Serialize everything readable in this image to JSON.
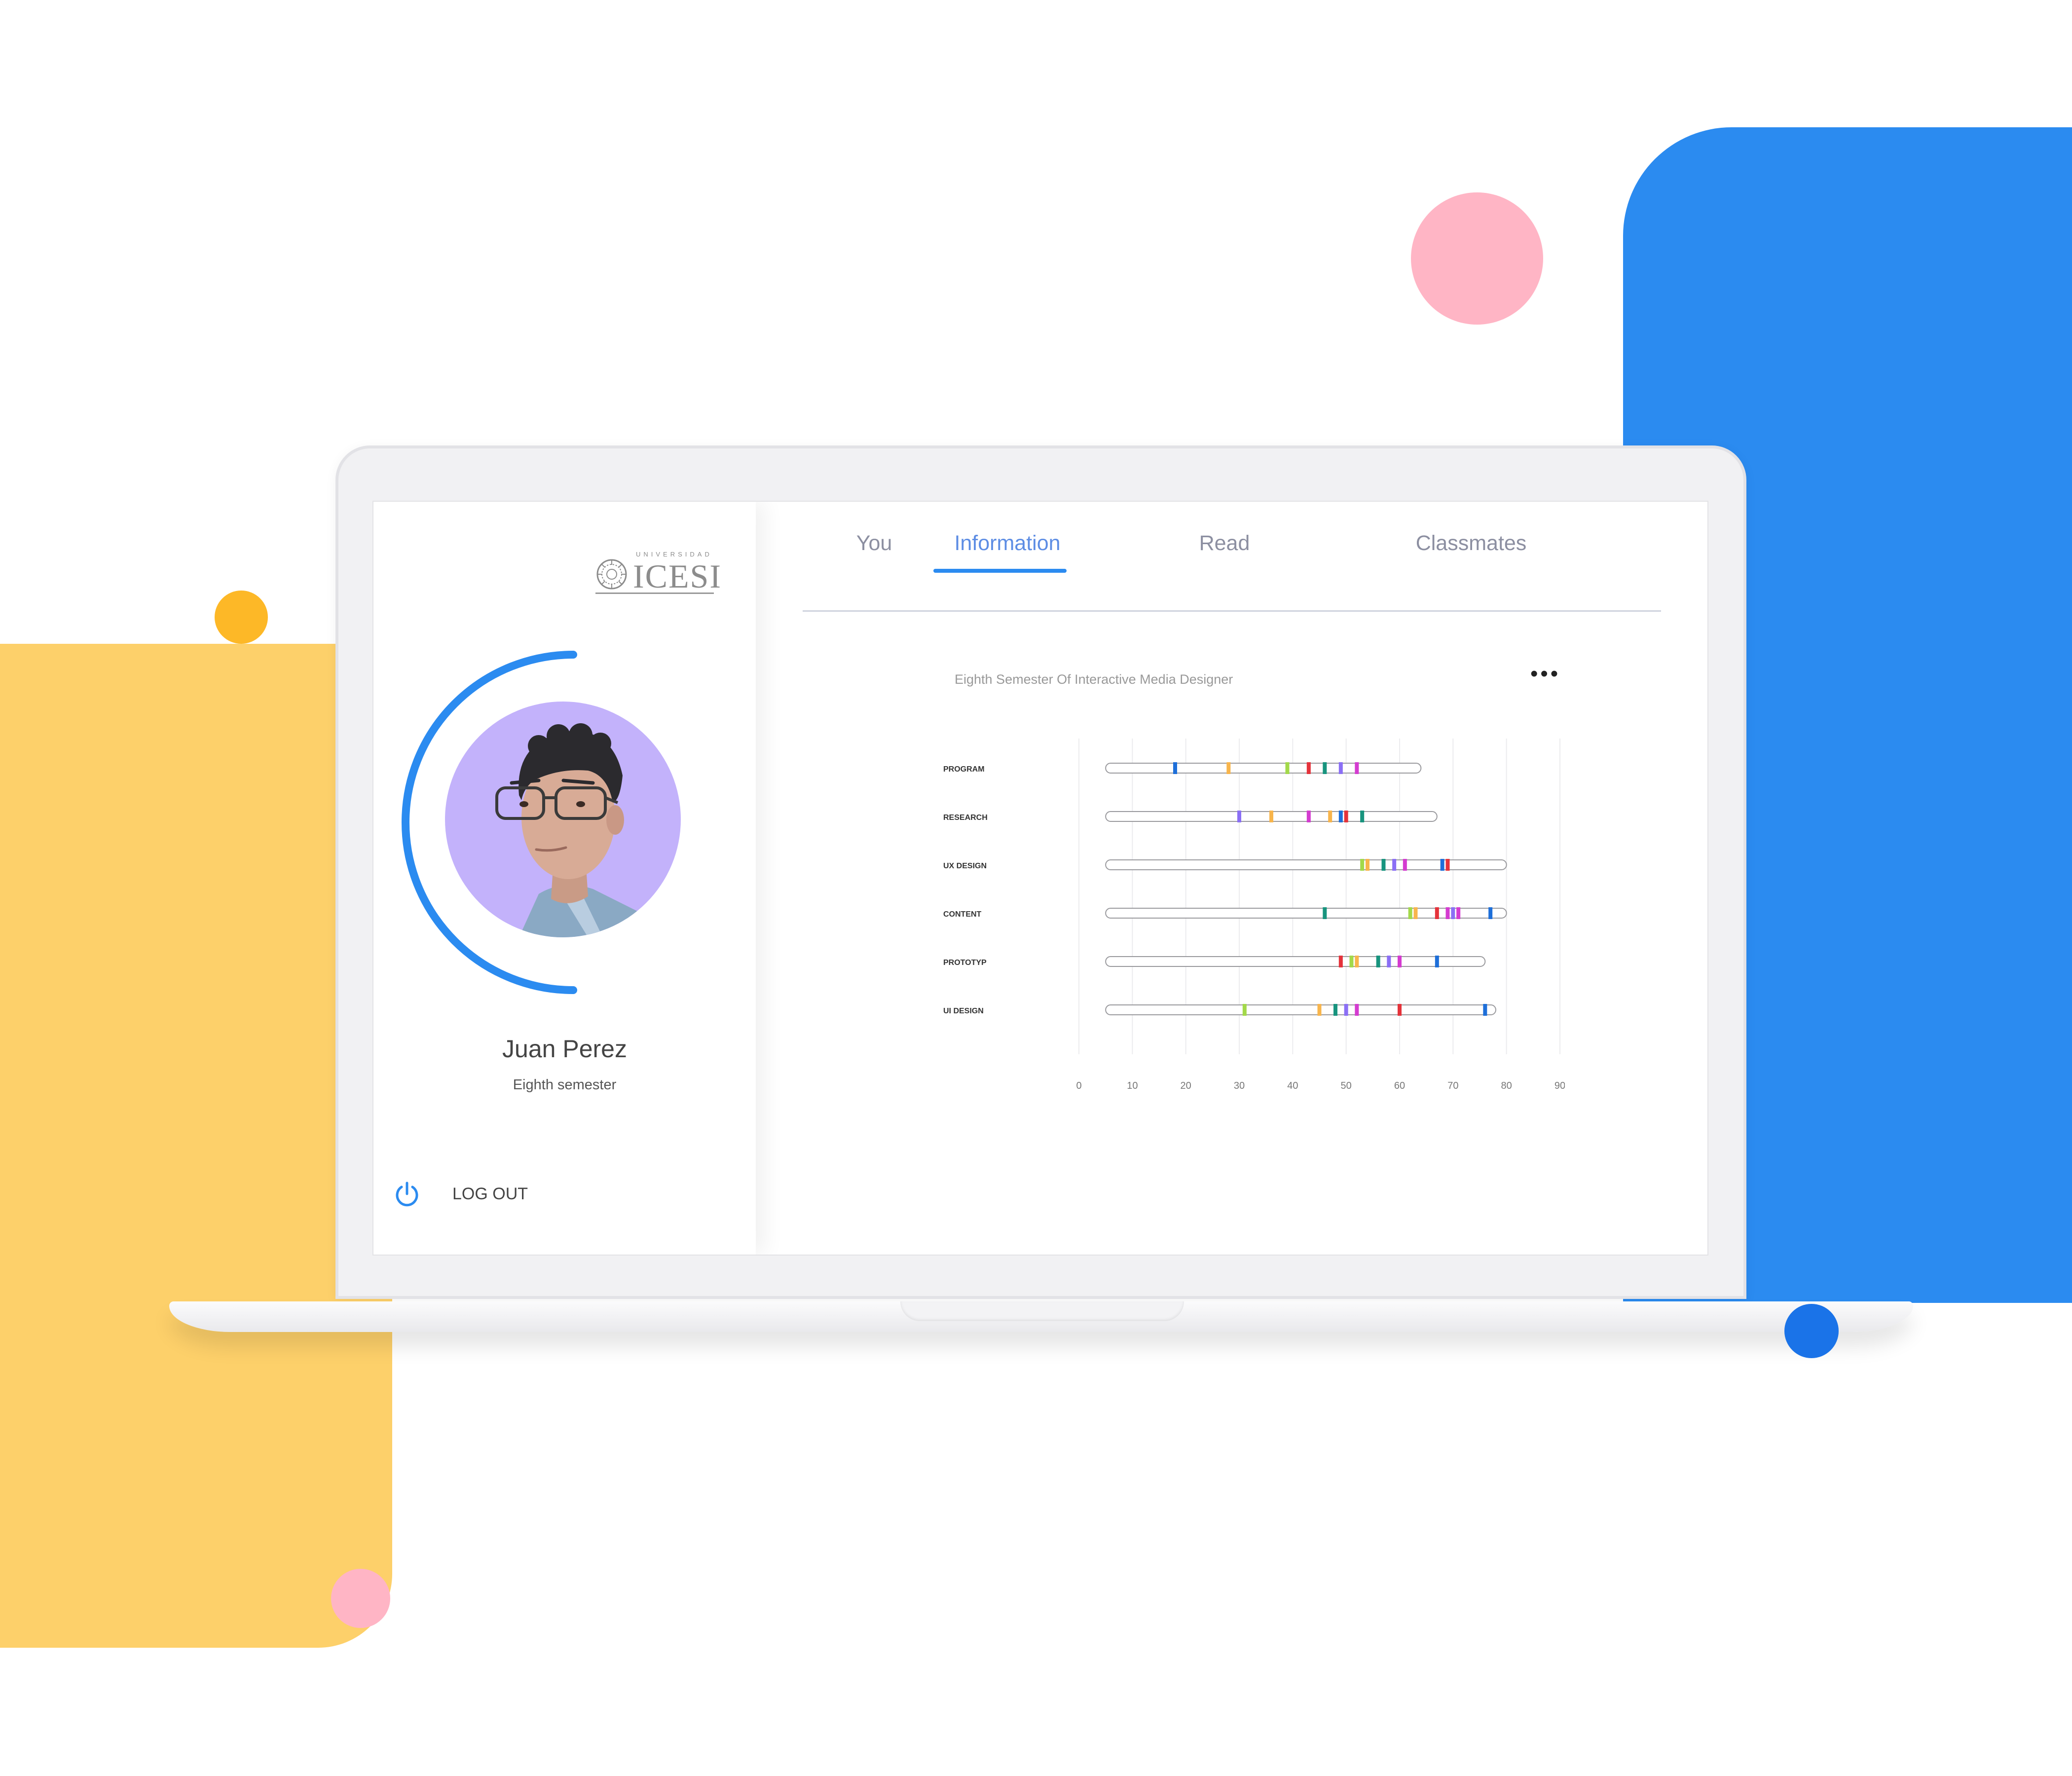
{
  "app": {
    "logo_small_text": "UNIVERSIDAD",
    "logo_big_text": "ICESI"
  },
  "profile": {
    "name": "Juan Perez",
    "semester": "Eighth semester",
    "accent_color": "#2b8bf0",
    "avatar_bg_color": "#c3b2fb"
  },
  "logout": {
    "label": "LOG OUT",
    "icon": "power-icon"
  },
  "tabs": [
    {
      "label": "You",
      "selected": false
    },
    {
      "label": "Information",
      "selected": true
    },
    {
      "label": "Read",
      "selected": false
    },
    {
      "label": "Classmates",
      "selected": false
    }
  ],
  "chart": {
    "title": "Eighth Semester Of Interactive Media Designer",
    "more_icon": "more-horizontal-icon"
  },
  "chart_data": {
    "type": "bar",
    "orientation": "horizontal",
    "title": "Eighth Semester Of Interactive Media Designer",
    "categories": [
      "PROGRAM",
      "RESEARCH",
      "UX DESIGN",
      "CONTENT",
      "PROTOTYP",
      "UI DESIGN"
    ],
    "range_start": 5,
    "values": [
      64,
      67,
      80,
      80,
      76,
      78
    ],
    "markers": [
      [
        {
          "x": 18,
          "color": "#1e6fd9"
        },
        {
          "x": 28,
          "color": "#f8b54c"
        },
        {
          "x": 39,
          "color": "#a3d94a"
        },
        {
          "x": 43,
          "color": "#e5333b"
        },
        {
          "x": 46,
          "color": "#18947e"
        },
        {
          "x": 49,
          "color": "#8b6ff5"
        },
        {
          "x": 52,
          "color": "#d43cd0"
        }
      ],
      [
        {
          "x": 30,
          "color": "#8b6ff5"
        },
        {
          "x": 36,
          "color": "#f8b54c"
        },
        {
          "x": 43,
          "color": "#d43cd0"
        },
        {
          "x": 47,
          "color": "#f8b54c"
        },
        {
          "x": 49,
          "color": "#1e6fd9"
        },
        {
          "x": 50,
          "color": "#e5333b"
        },
        {
          "x": 53,
          "color": "#18947e"
        }
      ],
      [
        {
          "x": 53,
          "color": "#a3d94a"
        },
        {
          "x": 54,
          "color": "#f8b54c"
        },
        {
          "x": 57,
          "color": "#18947e"
        },
        {
          "x": 59,
          "color": "#8b6ff5"
        },
        {
          "x": 61,
          "color": "#d43cd0"
        },
        {
          "x": 68,
          "color": "#1e6fd9"
        },
        {
          "x": 69,
          "color": "#e5333b"
        }
      ],
      [
        {
          "x": 46,
          "color": "#18947e"
        },
        {
          "x": 62,
          "color": "#a3d94a"
        },
        {
          "x": 63,
          "color": "#f8b54c"
        },
        {
          "x": 67,
          "color": "#e5333b"
        },
        {
          "x": 69,
          "color": "#d43cd0"
        },
        {
          "x": 70,
          "color": "#8b6ff5"
        },
        {
          "x": 71,
          "color": "#d43cd0"
        },
        {
          "x": 77,
          "color": "#1e6fd9"
        }
      ],
      [
        {
          "x": 49,
          "color": "#e5333b"
        },
        {
          "x": 51,
          "color": "#a3d94a"
        },
        {
          "x": 52,
          "color": "#f8b54c"
        },
        {
          "x": 56,
          "color": "#18947e"
        },
        {
          "x": 58,
          "color": "#8b6ff5"
        },
        {
          "x": 60,
          "color": "#d43cd0"
        },
        {
          "x": 67,
          "color": "#1e6fd9"
        }
      ],
      [
        {
          "x": 31,
          "color": "#a3d94a"
        },
        {
          "x": 45,
          "color": "#f8b54c"
        },
        {
          "x": 48,
          "color": "#18947e"
        },
        {
          "x": 50,
          "color": "#8b6ff5"
        },
        {
          "x": 52,
          "color": "#d43cd0"
        },
        {
          "x": 60,
          "color": "#e5333b"
        },
        {
          "x": 76,
          "color": "#1e6fd9"
        }
      ]
    ],
    "x_ticks": [
      0,
      10,
      20,
      30,
      40,
      50,
      60,
      70,
      80,
      90
    ],
    "xlim": [
      0,
      90
    ],
    "grid": true,
    "legend": "none",
    "colors": {
      "blue": "#1e6fd9",
      "orange": "#f8b54c",
      "lime": "#a3d94a",
      "red": "#e5333b",
      "teal": "#18947e",
      "purple": "#8b6ff5",
      "magenta": "#d43cd0"
    }
  }
}
